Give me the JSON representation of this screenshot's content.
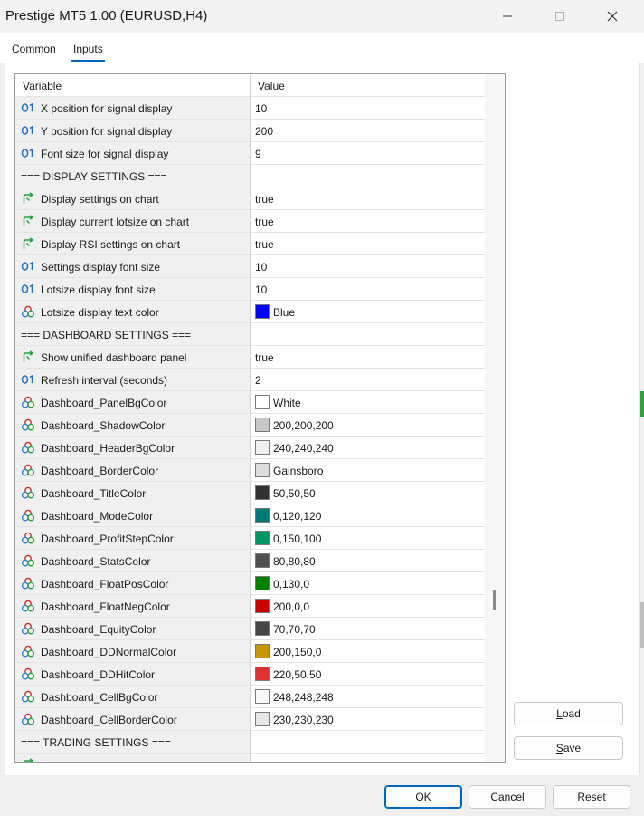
{
  "window": {
    "title": "Prestige MT5 1.00 (EURUSD,H4)",
    "controls": [
      "minimize",
      "maximize",
      "close"
    ]
  },
  "tabs": [
    {
      "label": "Common",
      "active": false
    },
    {
      "label": "Inputs",
      "active": true
    }
  ],
  "grid": {
    "columns": [
      "Variable",
      "Value"
    ],
    "rows": [
      {
        "type": "int",
        "icon": "int-icon",
        "variable": "X position for signal display",
        "value": "10"
      },
      {
        "type": "int",
        "icon": "int-icon",
        "variable": "Y position for signal display",
        "value": "200"
      },
      {
        "type": "int",
        "icon": "int-icon",
        "variable": "Font size for signal display",
        "value": "9"
      },
      {
        "type": "section",
        "variable": "=== DISPLAY SETTINGS ===",
        "value": ""
      },
      {
        "type": "bool",
        "icon": "bool-icon",
        "variable": "Display settings on chart",
        "value": "true"
      },
      {
        "type": "bool",
        "icon": "bool-icon",
        "variable": "Display current lotsize on chart",
        "value": "true"
      },
      {
        "type": "bool",
        "icon": "bool-icon",
        "variable": "Display RSI settings on chart",
        "value": "true"
      },
      {
        "type": "int",
        "icon": "int-icon",
        "variable": "Settings display font size",
        "value": "10"
      },
      {
        "type": "int",
        "icon": "int-icon",
        "variable": "Lotsize display font size",
        "value": "10"
      },
      {
        "type": "color",
        "icon": "color-icon",
        "variable": "Lotsize display text color",
        "value": "Blue",
        "swatch": "#0000ff"
      },
      {
        "type": "section",
        "variable": "=== DASHBOARD SETTINGS ===",
        "value": ""
      },
      {
        "type": "bool",
        "icon": "bool-icon",
        "variable": "Show unified dashboard panel",
        "value": "true"
      },
      {
        "type": "int",
        "icon": "int-icon",
        "variable": "Refresh interval (seconds)",
        "value": "2"
      },
      {
        "type": "color",
        "icon": "color-icon",
        "variable": "Dashboard_PanelBgColor",
        "value": "White",
        "swatch": "#ffffff"
      },
      {
        "type": "color",
        "icon": "color-icon",
        "variable": "Dashboard_ShadowColor",
        "value": "200,200,200",
        "swatch": "#c8c8c8"
      },
      {
        "type": "color",
        "icon": "color-icon",
        "variable": "Dashboard_HeaderBgColor",
        "value": "240,240,240",
        "swatch": "#f0f0f0"
      },
      {
        "type": "color",
        "icon": "color-icon",
        "variable": "Dashboard_BorderColor",
        "value": "Gainsboro",
        "swatch": "#dcdcdc"
      },
      {
        "type": "color",
        "icon": "color-icon",
        "variable": "Dashboard_TitleColor",
        "value": "50,50,50",
        "swatch": "#323232"
      },
      {
        "type": "color",
        "icon": "color-icon",
        "variable": "Dashboard_ModeColor",
        "value": "0,120,120",
        "swatch": "#007878"
      },
      {
        "type": "color",
        "icon": "color-icon",
        "variable": "Dashboard_ProfitStepColor",
        "value": "0,150,100",
        "swatch": "#009664"
      },
      {
        "type": "color",
        "icon": "color-icon",
        "variable": "Dashboard_StatsColor",
        "value": "80,80,80",
        "swatch": "#505050"
      },
      {
        "type": "color",
        "icon": "color-icon",
        "variable": "Dashboard_FloatPosColor",
        "value": "0,130,0",
        "swatch": "#008200"
      },
      {
        "type": "color",
        "icon": "color-icon",
        "variable": "Dashboard_FloatNegColor",
        "value": "200,0,0",
        "swatch": "#c80000"
      },
      {
        "type": "color",
        "icon": "color-icon",
        "variable": "Dashboard_EquityColor",
        "value": "70,70,70",
        "swatch": "#464646"
      },
      {
        "type": "color",
        "icon": "color-icon",
        "variable": "Dashboard_DDNormalColor",
        "value": "200,150,0",
        "swatch": "#c89600"
      },
      {
        "type": "color",
        "icon": "color-icon",
        "variable": "Dashboard_DDHitColor",
        "value": "220,50,50",
        "swatch": "#dc3232"
      },
      {
        "type": "color",
        "icon": "color-icon",
        "variable": "Dashboard_CellBgColor",
        "value": "248,248,248",
        "swatch": "#f8f8f8"
      },
      {
        "type": "color",
        "icon": "color-icon",
        "variable": "Dashboard_CellBorderColor",
        "value": "230,230,230",
        "swatch": "#e6e6e6"
      },
      {
        "type": "section",
        "variable": "=== TRADING SETTINGS ===",
        "value": ""
      },
      {
        "type": "partial",
        "icon": "bool-icon",
        "variable": "",
        "value": ""
      }
    ]
  },
  "buttons": {
    "load": {
      "label": "Load",
      "mnemonic": "L",
      "rest": "oad"
    },
    "save": {
      "label": "Save",
      "mnemonic": "S",
      "rest": "ave"
    },
    "ok": "OK",
    "cancel": "Cancel",
    "reset": "Reset"
  },
  "colors": {
    "accent": "#0067c0",
    "int_icon": "#1f6fc0",
    "bool_icon": "#22a03a"
  }
}
